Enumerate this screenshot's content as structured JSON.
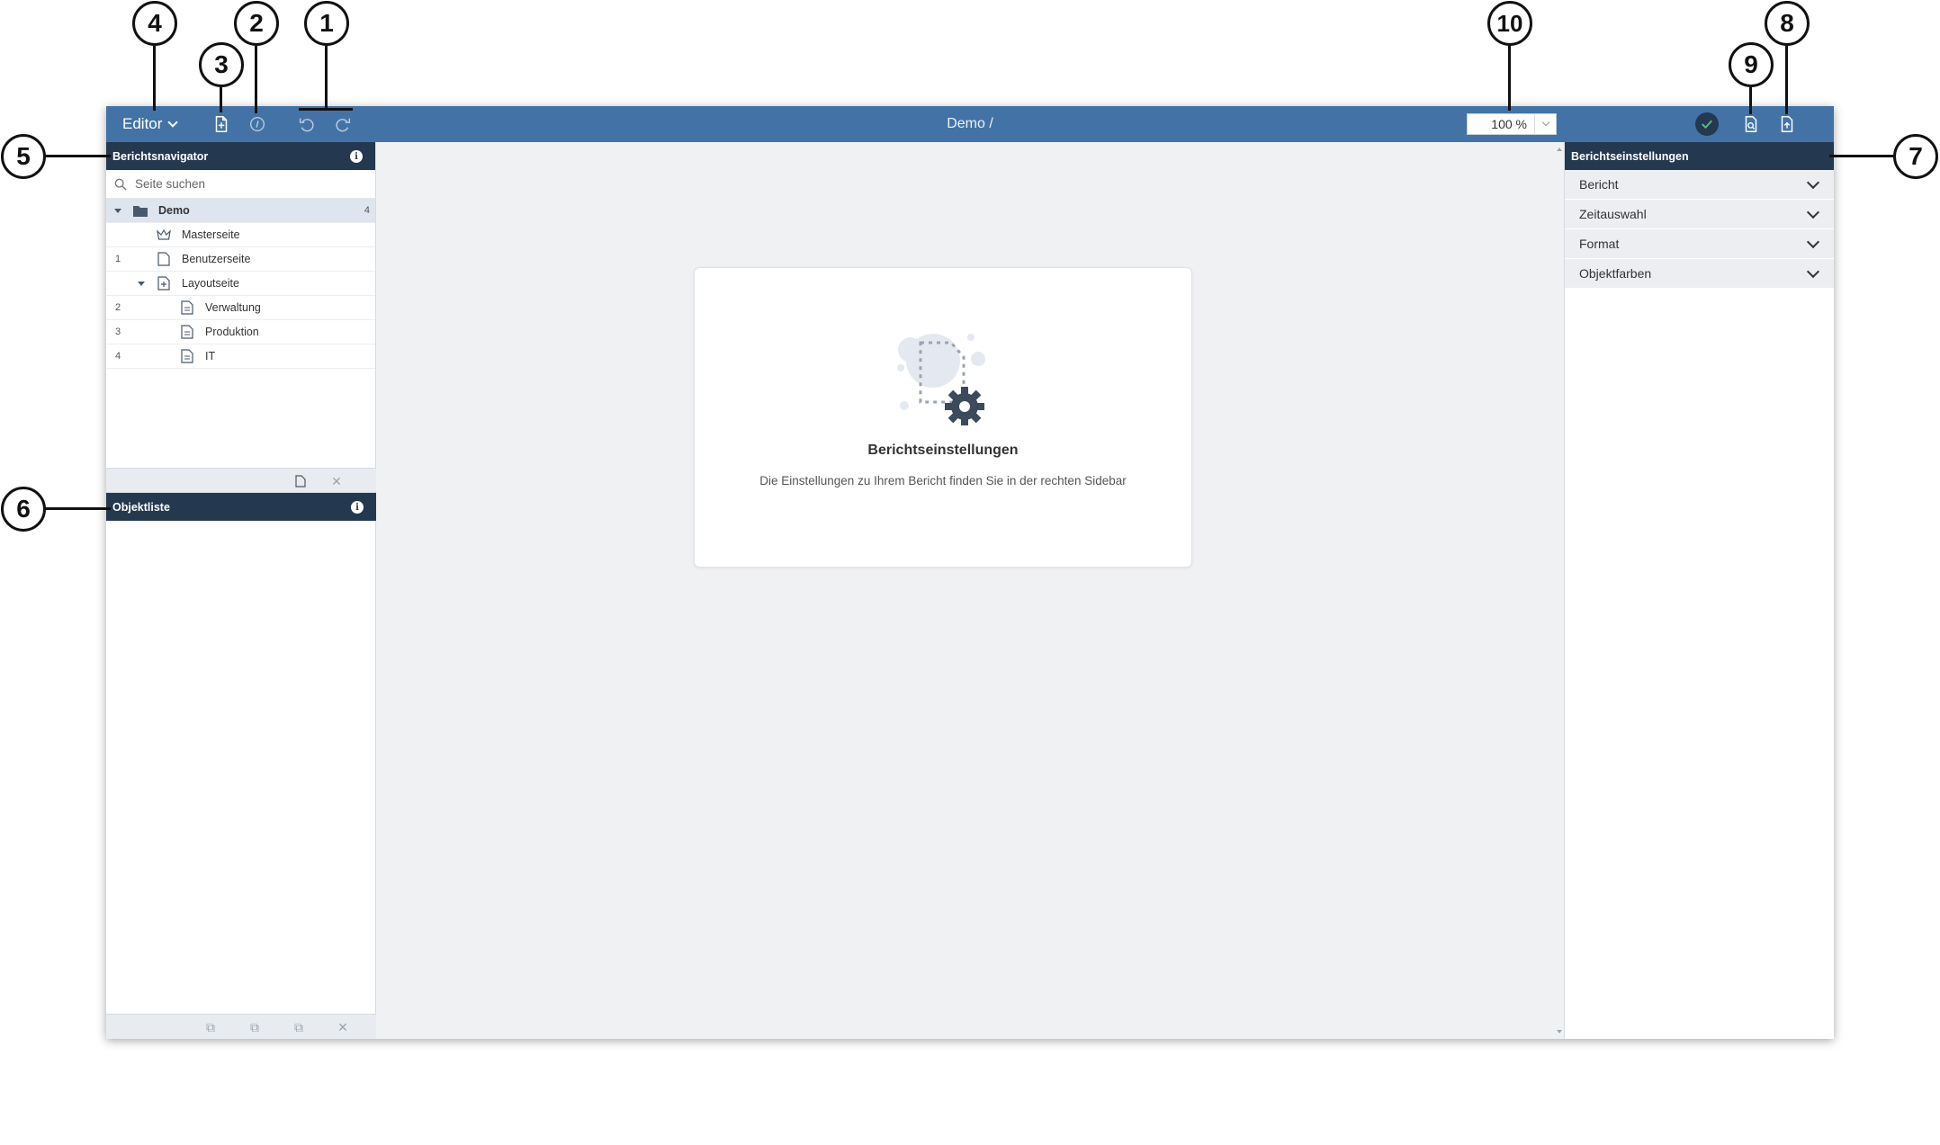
{
  "toolbar": {
    "mode_label": "Editor",
    "document_title": "Demo /",
    "zoom_value": "100 %",
    "icons": {
      "new_page": "file-plus-icon",
      "info": "info-circle-icon",
      "undo": "undo-icon",
      "redo": "redo-icon",
      "status": "check-circle-icon",
      "preview": "file-search-icon",
      "export": "file-export-icon"
    }
  },
  "navigator": {
    "title": "Berichtsnavigator",
    "search_placeholder": "Seite suchen",
    "root": {
      "label": "Demo",
      "count": "4"
    },
    "items": [
      {
        "num": "",
        "label": "Masterseite",
        "icon": "crown-icon"
      },
      {
        "num": "1",
        "label": "Benutzerseite",
        "icon": "page-icon"
      },
      {
        "num": "",
        "label": "Layoutseite",
        "icon": "layout-page-icon"
      },
      {
        "num": "2",
        "label": "Verwaltung",
        "icon": "document-icon"
      },
      {
        "num": "3",
        "label": "Produktion",
        "icon": "document-icon"
      },
      {
        "num": "4",
        "label": "IT",
        "icon": "document-icon"
      }
    ]
  },
  "object_list": {
    "title": "Objektliste"
  },
  "center_card": {
    "title": "Berichtseinstellungen",
    "text": "Die Einstellungen zu Ihrem Bericht finden Sie in der rechten Sidebar"
  },
  "settings": {
    "title": "Berichtseinstellungen",
    "sections": [
      "Bericht",
      "Zeitauswahl",
      "Format",
      "Objektfarben"
    ]
  },
  "callouts": [
    "1",
    "2",
    "3",
    "4",
    "5",
    "6",
    "7",
    "8",
    "9",
    "10"
  ],
  "colors": {
    "toolbar": "#4373a6",
    "panel_header": "#24384f",
    "workspace": "#f0f1f3",
    "tree_selected": "#dfe5ee"
  }
}
